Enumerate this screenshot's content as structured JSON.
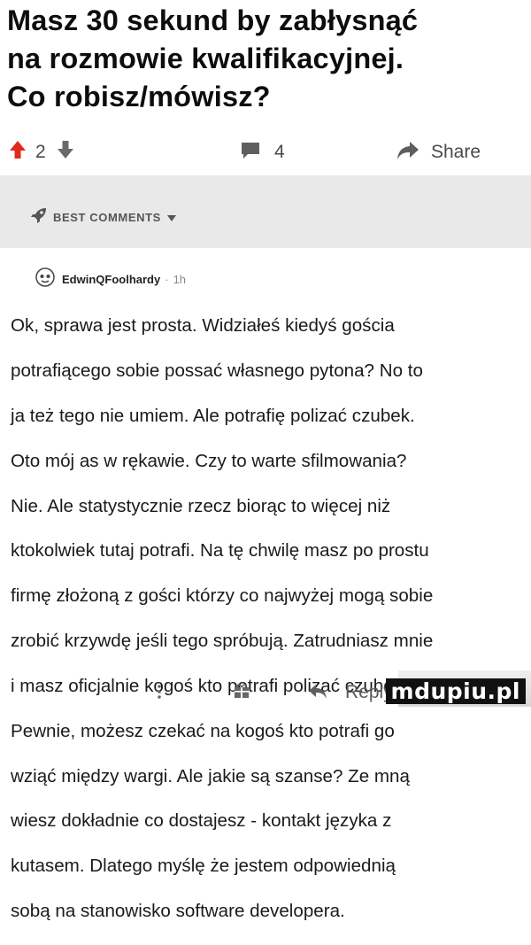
{
  "post": {
    "title": "Masz 30 sekund by zabłysnąć\nna rozmowie kwalifikacyjnej.\nCo robisz/mówisz?"
  },
  "actions": {
    "upvote_icon": "up-arrow-icon",
    "score": "2",
    "downvote_icon": "down-arrow-icon",
    "comments_icon": "comment-icon",
    "comment_count": "4",
    "share_icon": "share-arrow-icon",
    "share_label": "Share"
  },
  "comments_header": {
    "label": "BEST COMMENTS",
    "icon": "rocket-icon"
  },
  "comment": {
    "author": "EdwinQFoolhardy",
    "separator": "·",
    "time": "1h",
    "lines": [
      "Ok, sprawa jest prosta. Widziałeś kiedyś gościa",
      "potrafiącego sobie possać własnego pytona? No to",
      "ja też tego nie umiem. Ale potrafię polizać czubek.",
      "Oto mój as w rękawie. Czy to warte sfilmowania?",
      "Nie. Ale statystycznie rzecz biorąc to więcej niż",
      "ktokolwiek tutaj potrafi. Na tę chwilę masz po prostu",
      "firmę złożoną z gości którzy co najwyżej mogą sobie",
      "zrobić krzywdę jeśli tego spróbują. Zatrudniasz mnie",
      "i masz oficjalnie kogoś kto potrafi polizać czubek.",
      "Pewnie, możesz czekać na kogoś kto potrafi go",
      "wziąć między wargi. Ale jakie są szanse? Ze mną",
      "wiesz dokładnie co dostajesz - kontakt języka z",
      "kutasem. Dlatego myślę że jestem odpowiednią",
      "sobą na stanowisko software developera."
    ]
  },
  "footer": {
    "more_icon": "more-vertical-icon",
    "gift_icon": "gift-icon",
    "reply_icon": "reply-arrow-icon",
    "reply_label": "Reply"
  },
  "watermark": {
    "text": "mdupiu.pl"
  },
  "colors": {
    "upvote": "#e0291c",
    "text_dark": "#0d0d0d",
    "muted": "#4a4a4a",
    "band": "#e9e9e9"
  }
}
